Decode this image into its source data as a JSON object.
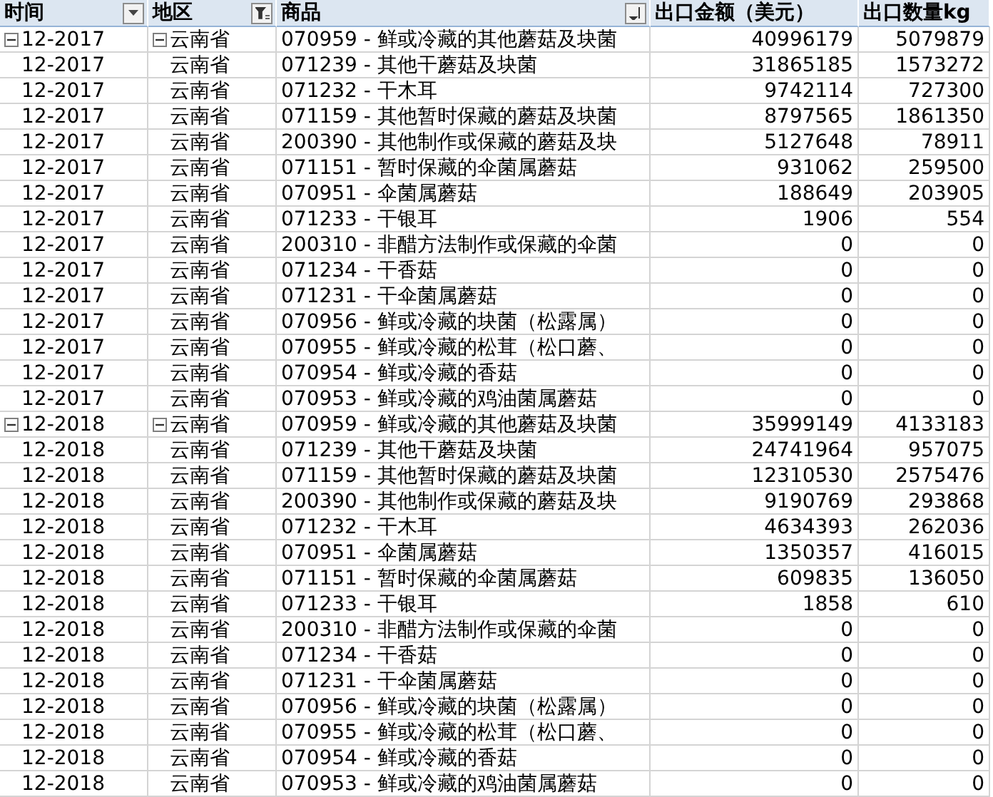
{
  "columns": [
    {
      "label": "时间",
      "kind": "dropdown"
    },
    {
      "label": "地区",
      "kind": "filter"
    },
    {
      "label": "商品",
      "kind": "sort"
    },
    {
      "label": "出口金额（美元）",
      "kind": "none"
    },
    {
      "label": "出口数量kg",
      "kind": "none"
    }
  ],
  "groups": [
    {
      "expanded": true,
      "region_expanded": true,
      "rows": [
        {
          "time": "12-2017",
          "region": "云南省",
          "product": "070959 - 鲜或冷藏的其他蘑菇及块菌",
          "amount": "40996179",
          "quantity": "5079879"
        },
        {
          "time": "12-2017",
          "region": "云南省",
          "product": "071239 - 其他干蘑菇及块菌",
          "amount": "31865185",
          "quantity": "1573272"
        },
        {
          "time": "12-2017",
          "region": "云南省",
          "product": "071232 - 干木耳",
          "amount": "9742114",
          "quantity": "727300"
        },
        {
          "time": "12-2017",
          "region": "云南省",
          "product": "071159 - 其他暂时保藏的蘑菇及块菌",
          "amount": "8797565",
          "quantity": "1861350"
        },
        {
          "time": "12-2017",
          "region": "云南省",
          "product": "200390 - 其他制作或保藏的蘑菇及块",
          "amount": "5127648",
          "quantity": "78911"
        },
        {
          "time": "12-2017",
          "region": "云南省",
          "product": "071151 - 暂时保藏的伞菌属蘑菇",
          "amount": "931062",
          "quantity": "259500"
        },
        {
          "time": "12-2017",
          "region": "云南省",
          "product": "070951 - 伞菌属蘑菇",
          "amount": "188649",
          "quantity": "203905"
        },
        {
          "time": "12-2017",
          "region": "云南省",
          "product": "071233 - 干银耳",
          "amount": "1906",
          "quantity": "554"
        },
        {
          "time": "12-2017",
          "region": "云南省",
          "product": "200310 - 非醋方法制作或保藏的伞菌",
          "amount": "0",
          "quantity": "0"
        },
        {
          "time": "12-2017",
          "region": "云南省",
          "product": "071234 - 干香菇",
          "amount": "0",
          "quantity": "0"
        },
        {
          "time": "12-2017",
          "region": "云南省",
          "product": "071231 - 干伞菌属蘑菇",
          "amount": "0",
          "quantity": "0"
        },
        {
          "time": "12-2017",
          "region": "云南省",
          "product": "070956 - 鲜或冷藏的块菌（松露属）",
          "amount": "0",
          "quantity": "0"
        },
        {
          "time": "12-2017",
          "region": "云南省",
          "product": "070955 - 鲜或冷藏的松茸（松口蘑、",
          "amount": "0",
          "quantity": "0"
        },
        {
          "time": "12-2017",
          "region": "云南省",
          "product": "070954 - 鲜或冷藏的香菇",
          "amount": "0",
          "quantity": "0"
        },
        {
          "time": "12-2017",
          "region": "云南省",
          "product": "070953 - 鲜或冷藏的鸡油菌属蘑菇",
          "amount": "0",
          "quantity": "0"
        }
      ]
    },
    {
      "expanded": true,
      "region_expanded": true,
      "rows": [
        {
          "time": "12-2018",
          "region": "云南省",
          "product": "070959 - 鲜或冷藏的其他蘑菇及块菌",
          "amount": "35999149",
          "quantity": "4133183"
        },
        {
          "time": "12-2018",
          "region": "云南省",
          "product": "071239 - 其他干蘑菇及块菌",
          "amount": "24741964",
          "quantity": "957075"
        },
        {
          "time": "12-2018",
          "region": "云南省",
          "product": "071159 - 其他暂时保藏的蘑菇及块菌",
          "amount": "12310530",
          "quantity": "2575476"
        },
        {
          "time": "12-2018",
          "region": "云南省",
          "product": "200390 - 其他制作或保藏的蘑菇及块",
          "amount": "9190769",
          "quantity": "293868"
        },
        {
          "time": "12-2018",
          "region": "云南省",
          "product": "071232 - 干木耳",
          "amount": "4634393",
          "quantity": "262036"
        },
        {
          "time": "12-2018",
          "region": "云南省",
          "product": "070951 - 伞菌属蘑菇",
          "amount": "1350357",
          "quantity": "416015"
        },
        {
          "time": "12-2018",
          "region": "云南省",
          "product": "071151 - 暂时保藏的伞菌属蘑菇",
          "amount": "609835",
          "quantity": "136050"
        },
        {
          "time": "12-2018",
          "region": "云南省",
          "product": "071233 - 干银耳",
          "amount": "1858",
          "quantity": "610"
        },
        {
          "time": "12-2018",
          "region": "云南省",
          "product": "200310 - 非醋方法制作或保藏的伞菌",
          "amount": "0",
          "quantity": "0"
        },
        {
          "time": "12-2018",
          "region": "云南省",
          "product": "071234 - 干香菇",
          "amount": "0",
          "quantity": "0"
        },
        {
          "time": "12-2018",
          "region": "云南省",
          "product": "071231 - 干伞菌属蘑菇",
          "amount": "0",
          "quantity": "0"
        },
        {
          "time": "12-2018",
          "region": "云南省",
          "product": "070956 - 鲜或冷藏的块菌（松露属）",
          "amount": "0",
          "quantity": "0"
        },
        {
          "time": "12-2018",
          "region": "云南省",
          "product": "070955 - 鲜或冷藏的松茸（松口蘑、",
          "amount": "0",
          "quantity": "0"
        },
        {
          "time": "12-2018",
          "region": "云南省",
          "product": "070954 - 鲜或冷藏的香菇",
          "amount": "0",
          "quantity": "0"
        },
        {
          "time": "12-2018",
          "region": "云南省",
          "product": "070953 - 鲜或冷藏的鸡油菌属蘑菇",
          "amount": "0",
          "quantity": "0"
        }
      ]
    }
  ]
}
